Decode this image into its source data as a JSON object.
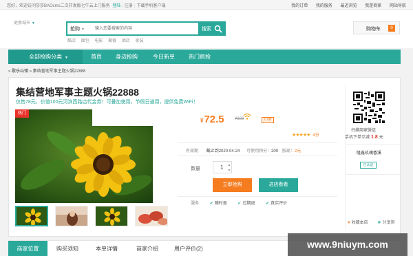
{
  "topbar": {
    "welcome": "您好，欢迎访问莎莎BAOcms二次开发版七牛云上门服务",
    "login": "登陆",
    "register": "注册",
    "download": "下载手机客户端",
    "links": [
      "我的订单",
      "我的服务",
      "最近浏览",
      "我是商家",
      "网站导航"
    ]
  },
  "header": {
    "city": "更换城市",
    "search_category": "抢购",
    "search_placeholder": "输入您要搜索的内容",
    "search_button": "搜索",
    "hot_words": [
      "酷店",
      "面包",
      "电影",
      "聚餐",
      "酒店",
      "家装"
    ],
    "cart_label": "购物车",
    "cart_count": "0"
  },
  "nav": {
    "all_categories": "全部抢购分类",
    "items": [
      "首页",
      "身边抢购",
      "今日新单",
      "热门疯抢"
    ]
  },
  "breadcrumb": {
    "prefix": "»",
    "category": "歌乐山镇",
    "current": "» 集结营地军事主题火锅22888"
  },
  "product": {
    "title": "集结营地军事主题火锅22888",
    "subtitle": "仅售78元，价值100元河滨西路店代金券！可叠加使用，节假日通用，提供免费WiFi！",
    "hot_badge": "热门",
    "currency": "¥",
    "price": "72.5",
    "old_price": "¥328",
    "discount": "2.2折",
    "stars": "★★★★★",
    "rating": "4分",
    "validity_label": "有效期",
    "validity_value": "截止到2020-04-24",
    "points_label": "可使用积分：",
    "points_value": "200",
    "rebate_label": "抵现：",
    "rebate_value": "2元",
    "qty_label": "数量",
    "qty_value": "1",
    "buy_button": "立即抢购",
    "shop_button": "进店看看",
    "service_label": "服务",
    "services": [
      "随时退",
      "过期退",
      "真实评价"
    ]
  },
  "side": {
    "qr_text": "扫描商家微信",
    "mobile_text": "手机下单立减",
    "mobile_amount": "1.8",
    "mobile_unit": "元",
    "merchant": "隆鑫玖瑰香溪",
    "certified": "已认证",
    "favorite": "收藏本店",
    "share": "分享到"
  },
  "tabs": [
    "商家位置",
    "购买须知",
    "本单详情",
    "商家介绍",
    "用户评价(2)"
  ],
  "watermark": "www.9niuym.com",
  "colors": {
    "accent": "#2aa99b",
    "price": "#f57c1f",
    "hot": "#e8332b"
  }
}
